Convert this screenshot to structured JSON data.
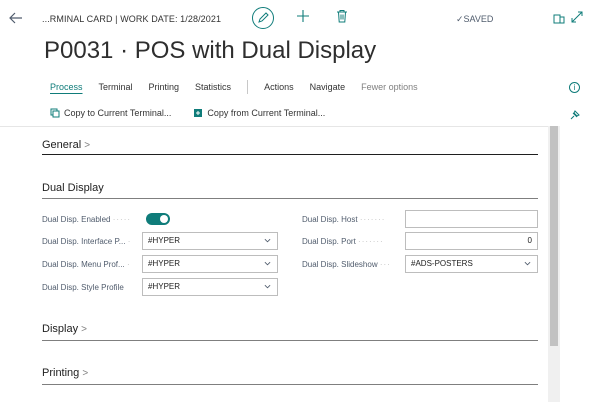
{
  "header": {
    "breadcrumb": "...RMINAL CARD | WORK DATE: 1/28/2021",
    "status": "✓SAVED",
    "title": "P0031 · POS with Dual Display"
  },
  "menu": {
    "tabs": [
      "Process",
      "Terminal",
      "Printing",
      "Statistics"
    ],
    "groups": [
      "Actions",
      "Navigate"
    ],
    "fewer": "Fewer options"
  },
  "actions": {
    "copy_to": "Copy to Current Terminal...",
    "copy_from": "Copy from Current Terminal..."
  },
  "sections": {
    "general": "General",
    "dual_display": "Dual Display",
    "display": "Display",
    "printing": "Printing"
  },
  "fields": {
    "enabled_label": "Dual Disp. Enabled",
    "enabled_value": true,
    "interface_label": "Dual Disp. Interface P...",
    "interface_value": "#HYPER",
    "menu_label": "Dual Disp. Menu Prof...",
    "menu_value": "#HYPER",
    "style_label": "Dual Disp. Style Profile",
    "style_value": "#HYPER",
    "host_label": "Dual Disp. Host",
    "host_value": "",
    "port_label": "Dual Disp. Port",
    "port_value": "0",
    "slideshow_label": "Dual Disp. Slideshow",
    "slideshow_value": "#ADS-POSTERS"
  },
  "colors": {
    "accent": "#0f7c7a",
    "text": "#212121",
    "label": "#505c6d"
  },
  "icons": [
    "back-arrow-icon",
    "pencil-icon",
    "plus-icon",
    "trash-icon",
    "open-new-window-icon",
    "expand-icon",
    "info-icon",
    "copy-to-icon",
    "copy-from-icon",
    "pin-icon",
    "chevron-right-icon",
    "chevron-down-icon"
  ]
}
